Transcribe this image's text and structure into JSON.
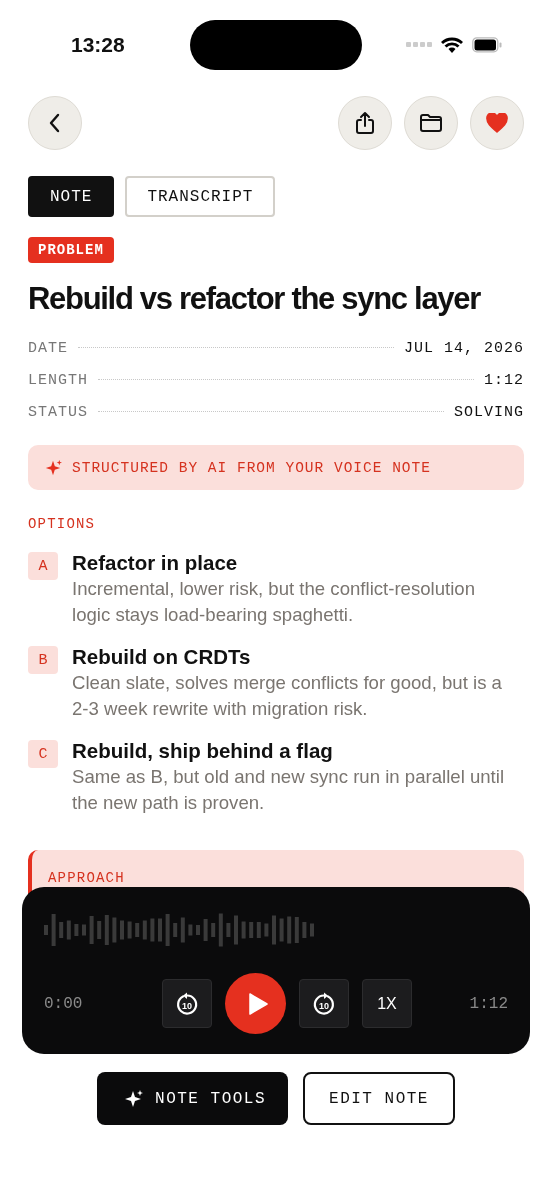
{
  "status_bar": {
    "time": "13:28"
  },
  "nav": {
    "buttons": [
      {
        "kind": "back"
      },
      {
        "kind": "share"
      },
      {
        "kind": "folder"
      },
      {
        "kind": "heart",
        "selected": true
      }
    ]
  },
  "tabs": [
    {
      "label": "NOTE",
      "selected": true
    },
    {
      "label": "TRANSCRIPT",
      "selected": false
    }
  ],
  "badge": "PROBLEM",
  "title": "Rebuild vs refactor the sync layer",
  "meta": [
    {
      "label": "DATE",
      "value": "JUL 14, 2026"
    },
    {
      "label": "LENGTH",
      "value": "1:12"
    },
    {
      "label": "STATUS",
      "value": "SOLVING"
    }
  ],
  "ai_banner": "STRUCTURED BY AI FROM YOUR VOICE NOTE",
  "options_heading": "OPTIONS",
  "options": [
    {
      "letter": "A",
      "title": "Refactor in place",
      "description": "Incremental, lower risk, but the conflict-resolution logic stays load-bearing spaghetti."
    },
    {
      "letter": "B",
      "title": "Rebuild on CRDTs",
      "description": "Clean slate, solves merge conflicts for good, but is a 2-3 week rewrite with migration risk."
    },
    {
      "letter": "C",
      "title": "Rebuild, ship behind a flag",
      "description": "Same as B, but old and new sync run in parallel until the new path is proven."
    }
  ],
  "approach_heading": "APPROACH",
  "player": {
    "elapsed": "0:00",
    "duration": "1:12",
    "skip_back": "10",
    "skip_forward": "10",
    "speed": "1X"
  },
  "actions": [
    {
      "label": "NOTE TOOLS",
      "kind": "primary"
    },
    {
      "label": "EDIT NOTE",
      "kind": "secondary"
    }
  ]
}
